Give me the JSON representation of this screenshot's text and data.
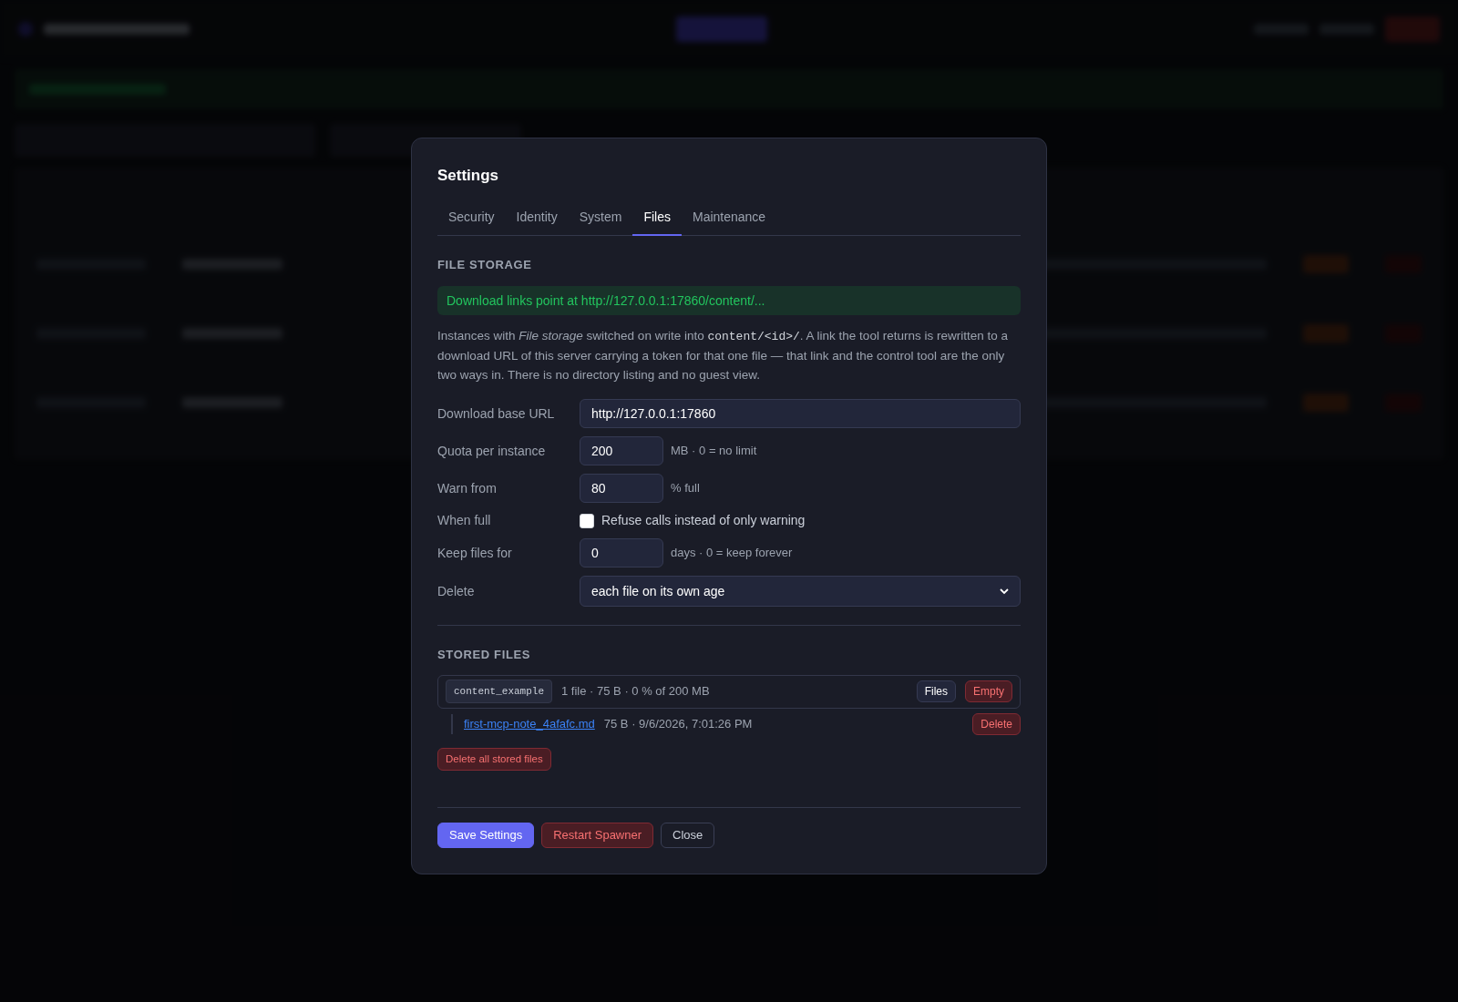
{
  "dialog": {
    "title": "Settings",
    "tabs": [
      {
        "label": "Security",
        "selected": false
      },
      {
        "label": "Identity",
        "selected": false
      },
      {
        "label": "System",
        "selected": false
      },
      {
        "label": "Files",
        "selected": true
      },
      {
        "label": "Maintenance",
        "selected": false
      }
    ],
    "file_storage": {
      "heading": "FILE STORAGE",
      "notice": "Download links point at http://127.0.0.1:17860/content/...",
      "description": "Instances with *File storage* switched on write into ",
      "description_code": "content/<id>/",
      "description_rest": ". A link the tool returns is rewritten to a download URL of this server carrying a token for that one file — that link and the control tool are the only two ways in. There is no directory listing and no guest view.",
      "fields": [
        {
          "kind": "text",
          "label": "Download base URL",
          "value": "http://127.0.0.1:17860"
        },
        {
          "kind": "number",
          "label": "Quota per instance",
          "value": "200",
          "hint": "MB · 0 = no limit"
        },
        {
          "kind": "number",
          "label": "Warn from",
          "value": "80",
          "hint": "% full"
        },
        {
          "kind": "checkbox",
          "label": "When full",
          "text": "Refuse calls instead of only warning",
          "checked": false
        },
        {
          "kind": "number",
          "label": "Keep files for",
          "value": "0",
          "hint": "days · 0 = keep forever"
        },
        {
          "kind": "select",
          "label": "Delete",
          "value": "each file on its own age"
        }
      ]
    },
    "stored_files": {
      "heading": "STORED FILES",
      "instances": [
        {
          "id": "content_example",
          "summary": "1 file · 75 B · 0 % of 200 MB",
          "files_button": "Files",
          "empty_button": "Empty",
          "files": [
            {
              "name": "first-mcp-note_4afafc.md",
              "meta": "75 B · 9/6/2026, 7:01:26 PM",
              "delete_button": "Delete"
            }
          ]
        }
      ],
      "delete_all": "Delete all stored files"
    },
    "buttons": [
      {
        "kind": "primary",
        "label": "Save Settings"
      },
      {
        "kind": "danger",
        "label": "Restart Spawner"
      },
      {
        "kind": "plain",
        "label": "Close"
      }
    ]
  }
}
